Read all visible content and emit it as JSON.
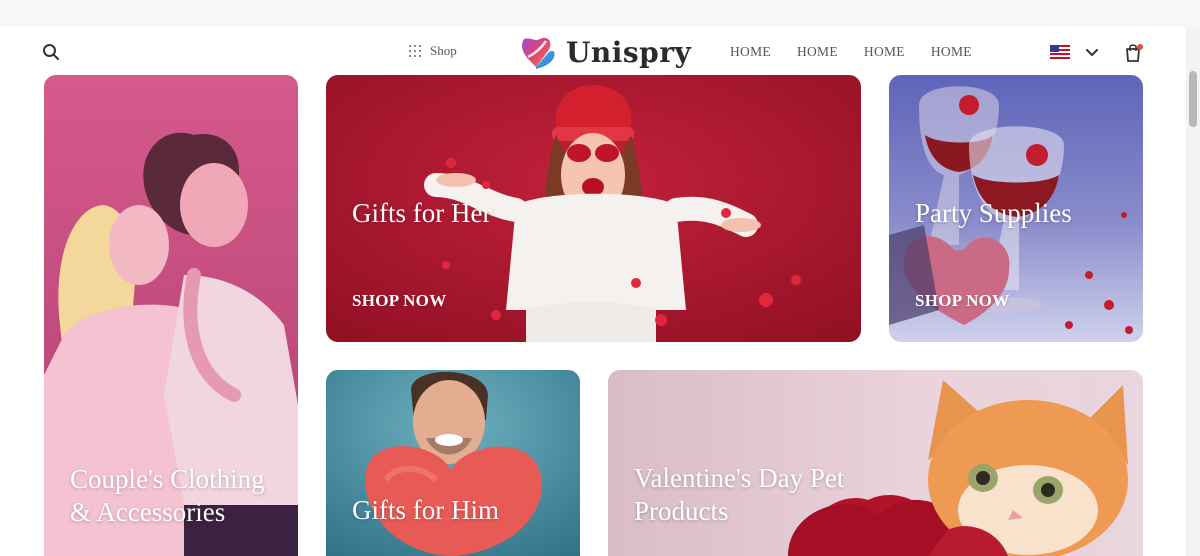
{
  "header": {
    "shop_label": "Shop",
    "brand": "Unispry",
    "nav": [
      "HOME",
      "HOME",
      "HOME",
      "HOME"
    ],
    "icons": {
      "search": "search-icon",
      "shop_grid": "grid-icon",
      "logo": "heart-logo-icon",
      "flag": "us-flag-icon",
      "chevron": "chevron-down-icon",
      "cart": "shopping-bag-icon"
    },
    "cart_badge_color": "#e74c3c"
  },
  "cards": {
    "couple": {
      "title_line1": "Couple's Clothing",
      "title_line2": "& Accessories"
    },
    "her": {
      "title": "Gifts for Her",
      "cta": "SHOP NOW"
    },
    "party": {
      "title": "Party Supplies",
      "cta": "SHOP NOW"
    },
    "him": {
      "title": "Gifts for Him"
    },
    "pet": {
      "title_line1": "Valentine's Day Pet",
      "title_line2": "Products"
    }
  },
  "colors": {
    "her_bg": "#b3162f",
    "couple_bg": "#d5578a",
    "party_bg": "#6f6fb5",
    "him_bg": "#3d8fa0",
    "pet_bg": "#e6c6d2"
  }
}
